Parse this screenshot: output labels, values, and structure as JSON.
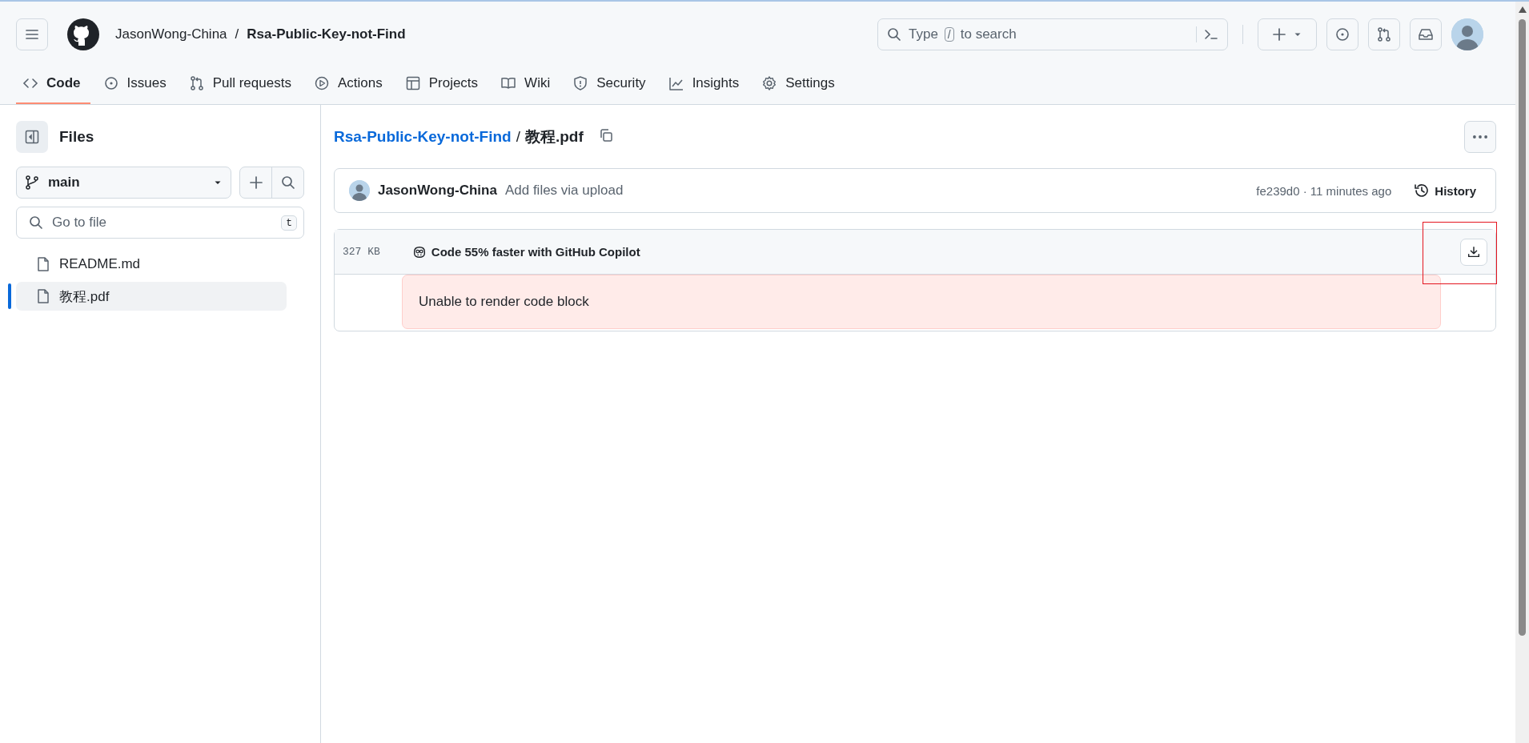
{
  "header": {
    "owner": "JasonWong-China",
    "separator": "/",
    "repo": "Rsa-Public-Key-not-Find",
    "search_hint": {
      "before": "Type",
      "key": "/",
      "after": "to search"
    }
  },
  "tabs": [
    {
      "kind": "code",
      "label": "Code",
      "selected": true
    },
    {
      "kind": "issues",
      "label": "Issues",
      "selected": false
    },
    {
      "kind": "pulls",
      "label": "Pull requests",
      "selected": false
    },
    {
      "kind": "actions",
      "label": "Actions",
      "selected": false
    },
    {
      "kind": "projects",
      "label": "Projects",
      "selected": false
    },
    {
      "kind": "wiki",
      "label": "Wiki",
      "selected": false
    },
    {
      "kind": "security",
      "label": "Security",
      "selected": false
    },
    {
      "kind": "insights",
      "label": "Insights",
      "selected": false
    },
    {
      "kind": "settings",
      "label": "Settings",
      "selected": false
    }
  ],
  "sidebar": {
    "title": "Files",
    "branch": "main",
    "filter": {
      "placeholder": "Go to file",
      "shortcut": "t"
    },
    "items": [
      {
        "name": "README.md",
        "selected": false
      },
      {
        "name": "教程.pdf",
        "selected": true
      }
    ]
  },
  "breadcrumb": {
    "repo": "Rsa-Public-Key-not-Find",
    "separator": "/",
    "file": "教程.pdf"
  },
  "commit": {
    "author": "JasonWong-China",
    "message": "Add files via upload",
    "meta": "fe239d0 · 11 minutes ago",
    "history": "History"
  },
  "file": {
    "size": "327 KB",
    "promo": "Code 55% faster with GitHub Copilot",
    "error": "Unable to render code block"
  }
}
